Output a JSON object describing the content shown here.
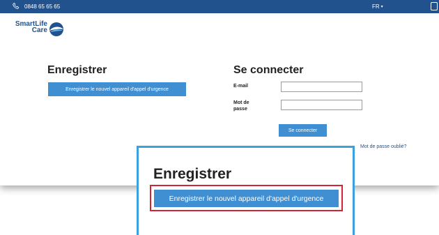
{
  "topbar": {
    "phone": "0848 65 65 65",
    "language": "FR",
    "language_caret": "▾"
  },
  "logo": {
    "line1": "SmartLife",
    "line2": "Care"
  },
  "register": {
    "title": "Enregistrer",
    "button_label": "Enregistrer le nouvel appareil d'appel d'urgence"
  },
  "login": {
    "title": "Se connecter",
    "email_label": "E-mail",
    "email_value": "",
    "password_label": "Mot de passe",
    "password_value": "",
    "submit_label": "Se connecter",
    "forgot_label": "Mot de passe oublié?"
  },
  "zoom": {
    "title": "Enregistrer",
    "button_label": "Enregistrer le nouvel appareil d'appel d'urgence"
  },
  "colors": {
    "topbar": "#22528d",
    "button": "#3f8fd2",
    "zoom_border": "#3aa0de",
    "highlight": "#d12533"
  }
}
